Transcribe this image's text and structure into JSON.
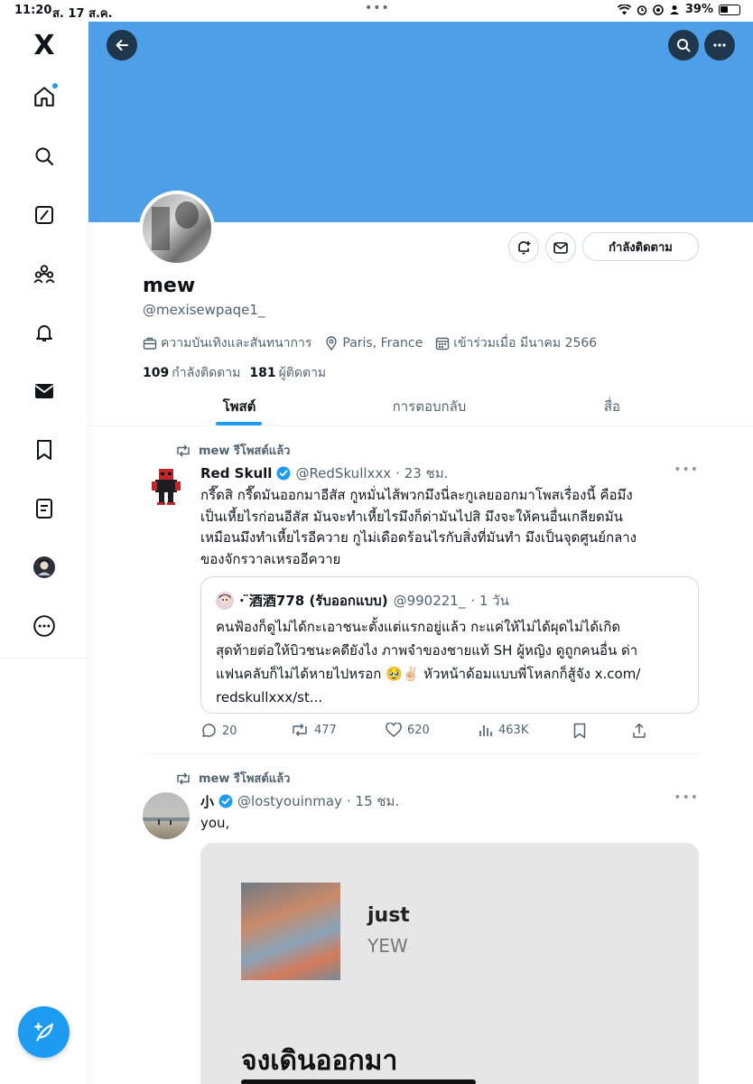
{
  "status_bar": {
    "time": "11:20",
    "date": "ส. 17 ส.ค.",
    "dots": "•••",
    "battery": "39%"
  },
  "sidebar": {
    "logo": "X",
    "items": [
      {
        "icon": "home-icon",
        "has_dot": true
      },
      {
        "icon": "search-icon"
      },
      {
        "icon": "grok-icon"
      },
      {
        "icon": "communities-icon"
      },
      {
        "icon": "notifications-icon"
      },
      {
        "icon": "messages-icon"
      },
      {
        "icon": "bookmarks-icon"
      },
      {
        "icon": "lists-icon"
      },
      {
        "icon": "profile-avatar-icon"
      },
      {
        "icon": "more-icon"
      }
    ],
    "compose_icon": "compose-feather-icon"
  },
  "colors": {
    "accent": "#1d9bf0",
    "banner": "#4e9ee8",
    "text_secondary": "#536471"
  },
  "profile": {
    "display_name": "mew",
    "handle": "@mexisewpaqe1_",
    "category": "ความบันเทิงและสันทนาการ",
    "location": "Paris, France",
    "joined": "เข้าร่วมเมื่อ มีนาคม 2566",
    "following_count": "109",
    "following_label": "กำลังติดตาม",
    "followers_count": "181",
    "followers_label": "ผู้ติดตาม",
    "follow_button": "กำลังติดตาม"
  },
  "tabs": [
    {
      "label": "โพสต์",
      "active": true
    },
    {
      "label": "การตอบกลับ",
      "active": false
    },
    {
      "label": "สื่อ",
      "active": false
    }
  ],
  "posts": [
    {
      "repost_label": "mew รีโพสต์แล้ว",
      "author_name": "Red Skull",
      "author_handle": "@RedSkullxxx",
      "time": "· 23 ชม.",
      "verified": true,
      "text_lines": [
        "กรี๊ดสิ กรี๊ดมันออกมาอีสัส กูหมั่นไส้พวกมึงนี่ละกูเลยออกมาโพสเรื่องนี้ คือมึง",
        "เป็นเหี้ยไรก่อนอีสัส มันจะทำเหี้ยไรมึงก็ด่ามันไปสิ มึงจะให้คนอื่นเกลียดมัน",
        "เหมือนมึงทำเหี้ยไรอีควาย กูไม่เดือดร้อนไรกับสิ่งที่มันทำ มึงเป็นจุดศูนย์กลาง",
        "ของจักรวาลเหรออีควาย"
      ],
      "quote": {
        "author_name": "· ̈酒酒778 (รับออกแบบ)",
        "author_handle": "@990221_",
        "time": "· 1 วัน",
        "text_lines": [
          "คนฟ้องก็ดูไม่ได้กะเอาชนะตั้งแต่แรกอยู่แล้ว กะแค่ให้ไม่ได้ผุดไม่ได้เกิด",
          "สุดท้ายต่อให้บิวชนะคดียังไง ภาพจำของชายแท้ SH ผู้หญิง ดูถูกคนอื่น ด่า",
          "แฟนคลับก็ไม่ได้หายไปหรอก 🥹✌🏻 หัวหน้าด้อมแบบพี่โหลกก็สู้จัง x.com/",
          "redskullxxx/st..."
        ]
      },
      "stats": {
        "replies": "20",
        "reposts": "477",
        "likes": "620",
        "views": "463K"
      }
    },
    {
      "repost_label": "mew รีโพสต์แล้ว",
      "author_name": "小",
      "author_handle": "@lostyouinmay",
      "time": "· 15 ชม.",
      "verified": true,
      "text": "you,",
      "media": {
        "track_title": "just",
        "track_artist": "YEW",
        "lyrics_line": "จงเดินออกมา"
      }
    }
  ]
}
